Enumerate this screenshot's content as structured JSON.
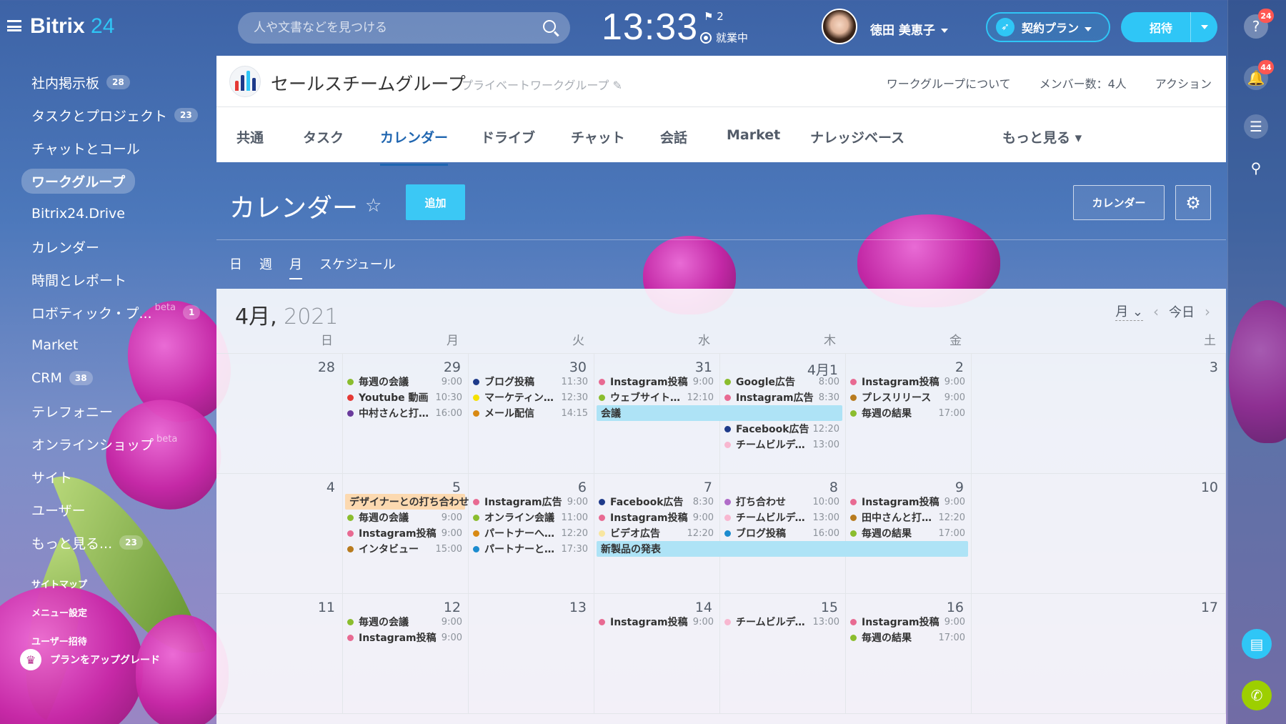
{
  "topbar": {
    "logo_main": "Bitrix",
    "logo_num": "24",
    "search_placeholder": "人や文書などを見つける",
    "clock": "13:33",
    "flag_count": "2",
    "work_status": "就業中",
    "user_name": "徳田 美恵子",
    "plan_label": "契約プラン",
    "invite_label": "招待"
  },
  "rail": {
    "help_badge": "24",
    "notif_badge": "44"
  },
  "sidebar": {
    "items": [
      {
        "label": "社内掲示板",
        "counter": "28"
      },
      {
        "label": "タスクとプロジェクト",
        "counter": "23"
      },
      {
        "label": "チャットとコール",
        "counter": ""
      },
      {
        "label": "ワークグループ",
        "counter": ""
      },
      {
        "label": "Bitrix24.Drive",
        "counter": ""
      },
      {
        "label": "カレンダー",
        "counter": ""
      },
      {
        "label": "時間とレポート",
        "counter": ""
      },
      {
        "label": "ロボティック・プ...",
        "counter": "1",
        "beta": "beta"
      },
      {
        "label": "Market",
        "counter": ""
      },
      {
        "label": "CRM",
        "counter": "38"
      },
      {
        "label": "テレフォニー",
        "counter": ""
      },
      {
        "label": "オンラインショップ",
        "counter": "",
        "beta": "beta"
      },
      {
        "label": "サイト",
        "counter": ""
      },
      {
        "label": "ユーザー",
        "counter": ""
      },
      {
        "label": "もっと見る...",
        "counter": "23"
      }
    ],
    "small_links": [
      "サイトマップ",
      "メニュー設定",
      "ユーザー招待"
    ],
    "upgrade_label": "プランをアップグレード"
  },
  "group": {
    "title": "セールスチームグループ",
    "type": "プライベートワークグループ",
    "about": "ワークグループについて",
    "members": "メンバー数：4人",
    "action": "アクション"
  },
  "tabs": [
    "共通",
    "タスク",
    "カレンダー",
    "ドライブ",
    "チャット",
    "会話",
    "Market",
    "ナレッジベース"
  ],
  "tabs_more": "もっと見る",
  "page": {
    "title": "カレンダー",
    "add_label": "追加",
    "calendar_button": "カレンダー",
    "views": [
      "日",
      "週",
      "月",
      "スケジュール"
    ]
  },
  "calendar": {
    "month": "4月,",
    "year": "2021",
    "mode": "月",
    "today": "今日",
    "weekdays": [
      "日",
      "月",
      "火",
      "水",
      "木",
      "金",
      "土"
    ],
    "colors": {
      "green": "#8bbd2e",
      "red": "#e53935",
      "purple": "#6a3b9c",
      "navy": "#1e3a8a",
      "yellow": "#f5e100",
      "orange": "#d88a14",
      "pink": "#e86a92",
      "lightpink": "#f8b7d0",
      "lightyellow": "#f8e6a0",
      "blue": "#1c8ccf",
      "lilac": "#b06cc8",
      "brown": "#b87b1e"
    },
    "weeks": [
      [
        {
          "day": "28",
          "events": []
        },
        {
          "day": "29",
          "events": [
            {
              "title": "毎週の会議",
              "time": "9:00",
              "color": "green"
            },
            {
              "title": "Youtube 動画",
              "time": "10:30",
              "color": "red"
            },
            {
              "title": "中村さんと打ち...",
              "time": "16:00",
              "color": "purple"
            }
          ]
        },
        {
          "day": "30",
          "events": [
            {
              "title": "ブログ投稿",
              "time": "11:30",
              "color": "navy"
            },
            {
              "title": "マーケティングプ...",
              "time": "12:30",
              "color": "yellow"
            },
            {
              "title": "メール配信",
              "time": "14:15",
              "color": "orange"
            }
          ]
        },
        {
          "day": "31",
          "events": [
            {
              "title": "Instagram投稿",
              "time": "9:00",
              "color": "pink"
            },
            {
              "title": "ウェブサイトの...",
              "time": "12:10",
              "color": "green"
            }
          ]
        },
        {
          "day": "4月1",
          "events": [
            {
              "title": "Google広告",
              "time": "8:00",
              "color": "green"
            },
            {
              "title": "Instagram広告",
              "time": "8:30",
              "color": "pink"
            },
            {
              "title": "",
              "time": "",
              "color": ""
            },
            {
              "title": "Facebook広告",
              "time": "12:20",
              "color": "navy"
            },
            {
              "title": "チームビルディン...",
              "time": "13:00",
              "color": "lightpink"
            }
          ]
        },
        {
          "day": "2",
          "events": [
            {
              "title": "Instagram投稿",
              "time": "9:00",
              "color": "pink"
            },
            {
              "title": "プレスリリース",
              "time": "9:00",
              "color": "brown"
            },
            {
              "title": "毎週の結果",
              "time": "17:00",
              "color": "green"
            }
          ]
        },
        {
          "day": "3",
          "events": []
        }
      ],
      [
        {
          "day": "4",
          "events": []
        },
        {
          "day": "5",
          "events": [
            {
              "title": "",
              "time": "",
              "color": ""
            },
            {
              "title": "毎週の会議",
              "time": "9:00",
              "color": "green"
            },
            {
              "title": "Instagram投稿",
              "time": "9:00",
              "color": "pink"
            },
            {
              "title": "インタビュー",
              "time": "15:00",
              "color": "brown"
            }
          ]
        },
        {
          "day": "6",
          "events": [
            {
              "title": "Instagram広告",
              "time": "9:00",
              "color": "pink"
            },
            {
              "title": "オンライン会議",
              "time": "11:00",
              "color": "green"
            },
            {
              "title": "パートナーへメ...",
              "time": "12:20",
              "color": "orange"
            },
            {
              "title": "パートナーと打...",
              "time": "17:30",
              "color": "blue"
            }
          ]
        },
        {
          "day": "7",
          "events": [
            {
              "title": "Facebook広告",
              "time": "8:30",
              "color": "navy"
            },
            {
              "title": "Instagram投稿",
              "time": "9:00",
              "color": "pink"
            },
            {
              "title": "ビデオ広告",
              "time": "12:20",
              "color": "lightyellow"
            }
          ]
        },
        {
          "day": "8",
          "events": [
            {
              "title": "打ち合わせ",
              "time": "10:00",
              "color": "lilac"
            },
            {
              "title": "チームビルディン...",
              "time": "13:00",
              "color": "lightpink"
            },
            {
              "title": "ブログ投稿",
              "time": "16:00",
              "color": "blue"
            }
          ]
        },
        {
          "day": "9",
          "events": [
            {
              "title": "Instagram投稿",
              "time": "9:00",
              "color": "pink"
            },
            {
              "title": "田中さんと打ち...",
              "time": "12:20",
              "color": "brown"
            },
            {
              "title": "毎週の結果",
              "time": "17:00",
              "color": "green"
            }
          ]
        },
        {
          "day": "10",
          "events": []
        }
      ],
      [
        {
          "day": "11",
          "events": []
        },
        {
          "day": "12",
          "events": [
            {
              "title": "毎週の会議",
              "time": "9:00",
              "color": "green"
            },
            {
              "title": "Instagram投稿",
              "time": "9:00",
              "color": "pink"
            }
          ]
        },
        {
          "day": "13",
          "events": []
        },
        {
          "day": "14",
          "events": [
            {
              "title": "Instagram投稿",
              "time": "9:00",
              "color": "pink"
            }
          ]
        },
        {
          "day": "15",
          "events": [
            {
              "title": "チームビルディン...",
              "time": "13:00",
              "color": "lightpink"
            }
          ]
        },
        {
          "day": "16",
          "events": [
            {
              "title": "Instagram投稿",
              "time": "9:00",
              "color": "pink"
            },
            {
              "title": "毎週の結果",
              "time": "17:00",
              "color": "green"
            }
          ]
        },
        {
          "day": "17",
          "events": []
        }
      ]
    ],
    "multi_day": [
      {
        "title": "会議",
        "week": 0,
        "start": 3,
        "span": 2,
        "row": 2,
        "style": "blue"
      },
      {
        "title": "デザイナーとの打ち合わせ",
        "week": 1,
        "start": 1,
        "span": 1,
        "row": 0,
        "style": "orange"
      },
      {
        "title": "新製品の発表",
        "week": 1,
        "start": 3,
        "span": 3,
        "row": 3,
        "style": "blue"
      }
    ]
  }
}
